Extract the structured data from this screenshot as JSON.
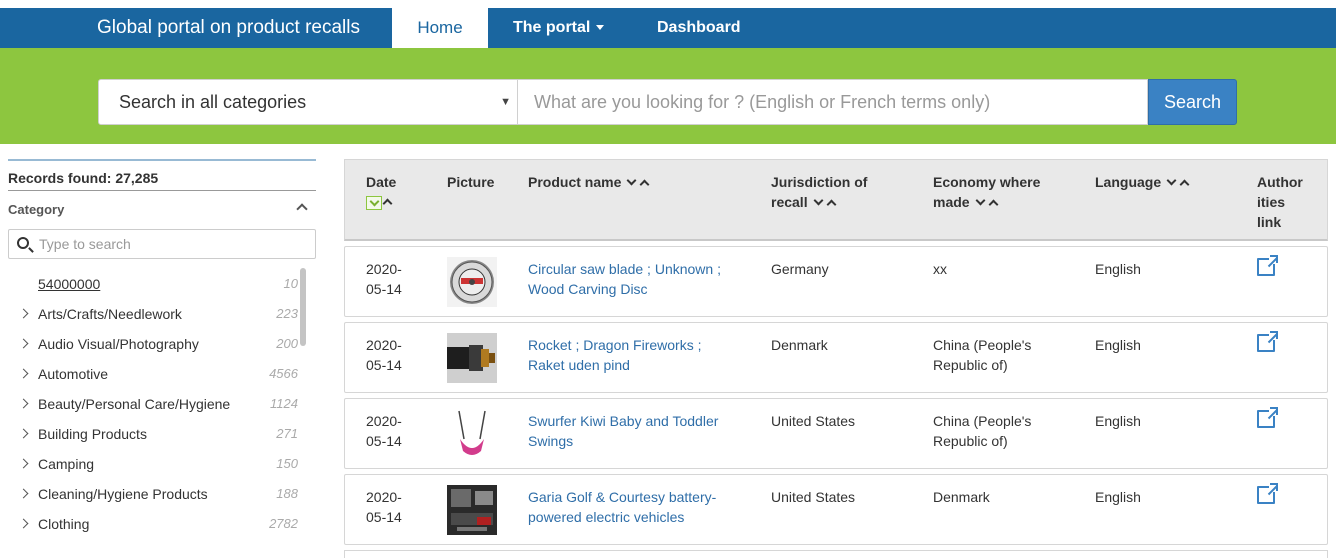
{
  "nav": {
    "brand": "Global portal on product recalls",
    "home": "Home",
    "portal": "The portal",
    "dashboard": "Dashboard"
  },
  "search": {
    "category_value": "Search in all categories",
    "placeholder": "What are you looking for ? (English or French terms only)",
    "button": "Search"
  },
  "sidebar": {
    "records": "Records found: 27,285",
    "category_title": "Category",
    "filter_placeholder": "Type to search",
    "items": [
      {
        "label": "54000000",
        "count": "10"
      },
      {
        "label": "Arts/Crafts/Needlework",
        "count": "223"
      },
      {
        "label": "Audio Visual/Photography",
        "count": "200"
      },
      {
        "label": "Automotive",
        "count": "4566"
      },
      {
        "label": "Beauty/Personal Care/Hygiene",
        "count": "1124"
      },
      {
        "label": "Building Products",
        "count": "271"
      },
      {
        "label": "Camping",
        "count": "150"
      },
      {
        "label": "Cleaning/Hygiene Products",
        "count": "188"
      },
      {
        "label": "Clothing",
        "count": "2782"
      }
    ]
  },
  "table": {
    "headers": {
      "date": "Date",
      "picture": "Picture",
      "product": "Product name",
      "jurisdiction_1": "Jurisdiction of",
      "jurisdiction_2": "recall",
      "economy_1": "Economy where",
      "economy_2": "made",
      "language": "Language",
      "authorities_1": "Author",
      "authorities_2": "ities",
      "authorities_3": "link"
    },
    "rows": [
      {
        "date_1": "2020-",
        "date_2": "05-14",
        "product_1": "Circular saw blade ; Unknown ;",
        "product_2": "Wood Carving Disc",
        "jurisdiction": "Germany",
        "economy_1": "xx",
        "economy_2": "",
        "language": "English"
      },
      {
        "date_1": "2020-",
        "date_2": "05-14",
        "product_1": "Rocket ; Dragon Fireworks ;",
        "product_2": "Raket uden pind",
        "jurisdiction": "Denmark",
        "economy_1": "China (People's",
        "economy_2": "Republic of)",
        "language": "English"
      },
      {
        "date_1": "2020-",
        "date_2": "05-14",
        "product_1": "Swurfer Kiwi Baby and Toddler",
        "product_2": "Swings",
        "jurisdiction": "United States",
        "economy_1": "China (People's",
        "economy_2": "Republic of)",
        "language": "English"
      },
      {
        "date_1": "2020-",
        "date_2": "05-14",
        "product_1": "Garia Golf & Courtesy battery-",
        "product_2": "powered electric vehicles",
        "jurisdiction": "United States",
        "economy_1": "Denmark",
        "economy_2": "",
        "language": "English"
      }
    ]
  },
  "colors": {
    "nav_blue": "#1a66a0",
    "band_green": "#8dc63f",
    "link_blue": "#2f6ea8",
    "button_blue": "#3a82c4"
  }
}
